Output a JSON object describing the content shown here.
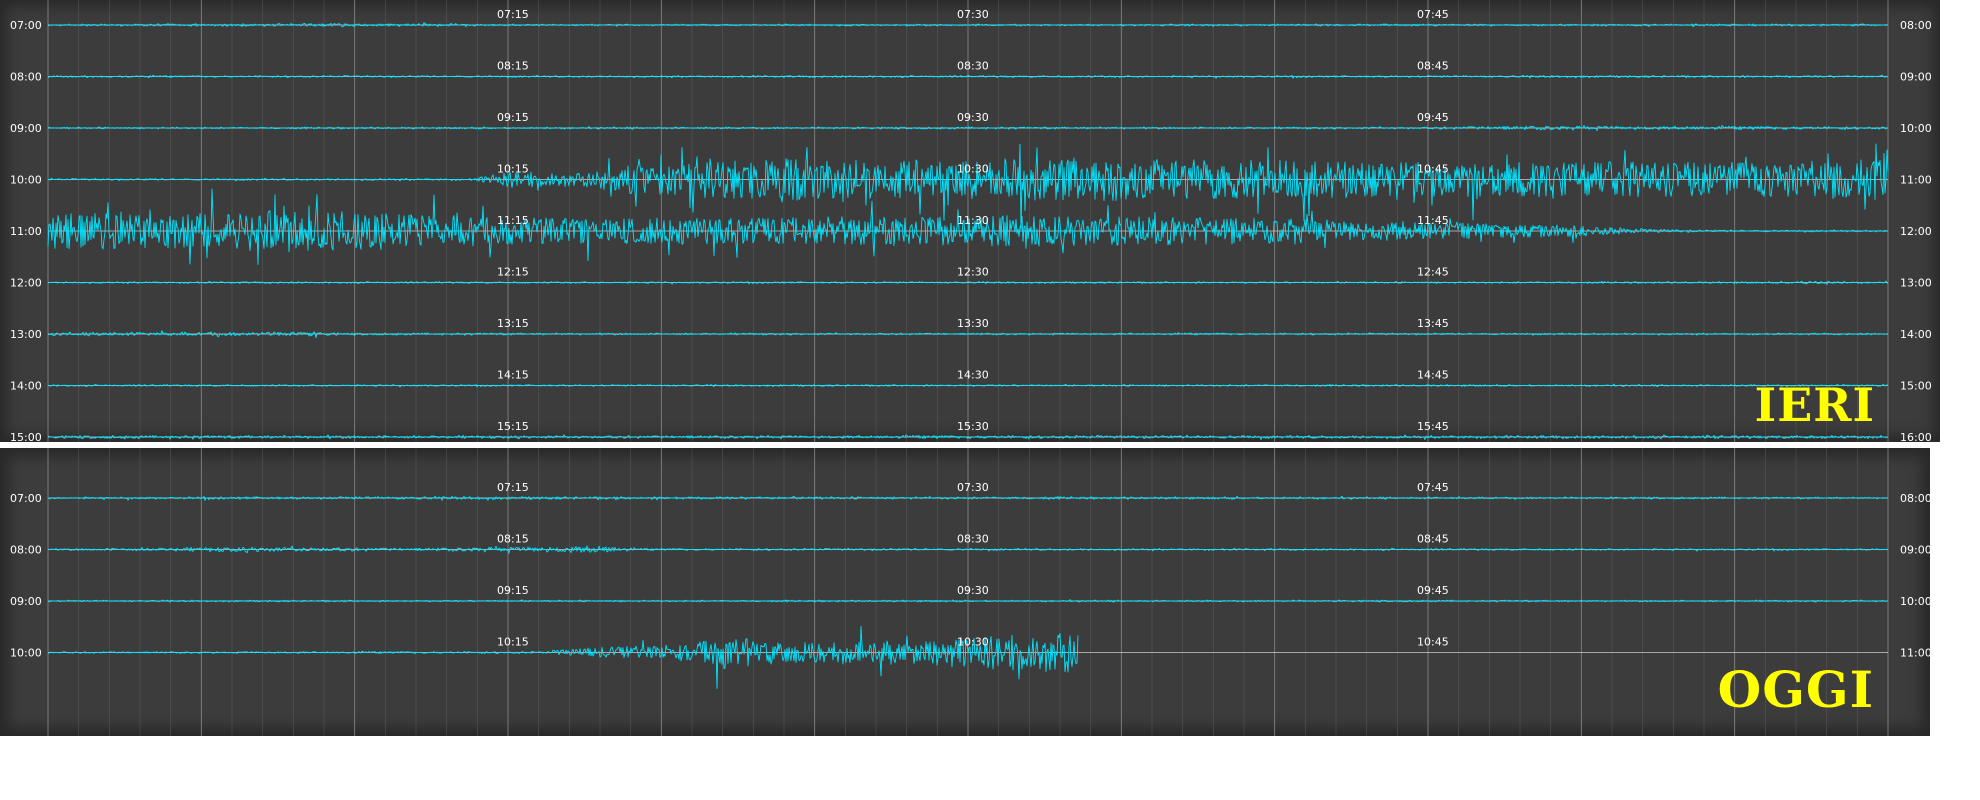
{
  "chart_data": [
    {
      "type": "line",
      "panel_label": "IERI",
      "colors": {
        "background": "#3c3c3c",
        "trace": "#00e5ff",
        "grid": "#7a7a7a",
        "tick_text": "#ffffff"
      },
      "rows": [
        {
          "left_label": "07:00",
          "right_label": "08:00",
          "mid_labels": [
            "07:15",
            "07:30",
            "07:45"
          ],
          "activity": [
            [
              0.0,
              0.03
            ],
            [
              0.17,
              0.06
            ],
            [
              0.25,
              0.02
            ],
            [
              1.0,
              0.03
            ]
          ]
        },
        {
          "left_label": "08:00",
          "right_label": "09:00",
          "mid_labels": [
            "08:15",
            "08:30",
            "08:45"
          ],
          "activity": [
            [
              0.0,
              0.02
            ],
            [
              1.0,
              0.03
            ]
          ]
        },
        {
          "left_label": "09:00",
          "right_label": "10:00",
          "mid_labels": [
            "09:15",
            "09:30",
            "09:45"
          ],
          "activity": [
            [
              0.0,
              0.02
            ],
            [
              0.74,
              0.03
            ],
            [
              0.8,
              0.08
            ],
            [
              1.0,
              0.04
            ]
          ]
        },
        {
          "left_label": "10:00",
          "right_label": "11:00",
          "mid_labels": [
            "10:15",
            "10:30",
            "10:45"
          ],
          "activity": [
            [
              0.0,
              0.02
            ],
            [
              0.23,
              0.03
            ],
            [
              0.25,
              0.35
            ],
            [
              0.29,
              0.3
            ],
            [
              0.31,
              0.6
            ],
            [
              0.4,
              0.95
            ],
            [
              0.48,
              0.85
            ],
            [
              0.56,
              1.0
            ],
            [
              0.65,
              0.85
            ],
            [
              0.78,
              0.8
            ],
            [
              0.9,
              0.8
            ],
            [
              1.0,
              0.9
            ]
          ]
        },
        {
          "left_label": "11:00",
          "right_label": "12:00",
          "mid_labels": [
            "11:15",
            "11:30",
            "11:45"
          ],
          "activity": [
            [
              0.0,
              0.8
            ],
            [
              0.1,
              0.8
            ],
            [
              0.11,
              1.0
            ],
            [
              0.2,
              0.75
            ],
            [
              0.3,
              0.55
            ],
            [
              0.45,
              0.65
            ],
            [
              0.55,
              0.7
            ],
            [
              0.68,
              0.55
            ],
            [
              0.76,
              0.35
            ],
            [
              0.83,
              0.25
            ],
            [
              0.86,
              0.1
            ],
            [
              0.9,
              0.03
            ],
            [
              1.0,
              0.02
            ]
          ]
        },
        {
          "left_label": "12:00",
          "right_label": "13:00",
          "mid_labels": [
            "12:15",
            "12:30",
            "12:45"
          ],
          "activity": [
            [
              0.0,
              0.02
            ],
            [
              0.94,
              0.02
            ],
            [
              0.96,
              0.08
            ],
            [
              0.98,
              0.02
            ],
            [
              1.0,
              0.02
            ]
          ]
        },
        {
          "left_label": "13:00",
          "right_label": "14:00",
          "mid_labels": [
            "13:15",
            "13:30",
            "13:45"
          ],
          "activity": [
            [
              0.0,
              0.06
            ],
            [
              0.15,
              0.08
            ],
            [
              0.16,
              0.03
            ],
            [
              1.0,
              0.02
            ]
          ]
        },
        {
          "left_label": "14:00",
          "right_label": "15:00",
          "mid_labels": [
            "14:15",
            "14:30",
            "14:45"
          ],
          "activity": [
            [
              0.0,
              0.02
            ],
            [
              1.0,
              0.02
            ]
          ]
        },
        {
          "left_label": "15:00",
          "right_label": "16:00",
          "mid_labels": [
            "15:15",
            "15:30",
            "15:45"
          ],
          "activity": [
            [
              0.0,
              0.05
            ],
            [
              1.0,
              0.05
            ]
          ]
        }
      ]
    },
    {
      "type": "line",
      "panel_label": "OGGI",
      "colors": {
        "background": "#3c3c3c",
        "trace": "#00e5ff",
        "grid": "#7a7a7a",
        "tick_text": "#ffffff"
      },
      "rows": [
        {
          "left_label": "07:00",
          "right_label": "08:00",
          "mid_labels": [
            "07:15",
            "07:30",
            "07:45"
          ],
          "activity": [
            [
              0.0,
              0.03
            ],
            [
              0.2,
              0.05
            ],
            [
              1.0,
              0.02
            ]
          ]
        },
        {
          "left_label": "08:00",
          "right_label": "09:00",
          "mid_labels": [
            "08:15",
            "08:30",
            "08:45"
          ],
          "activity": [
            [
              0.0,
              0.02
            ],
            [
              0.11,
              0.1
            ],
            [
              0.2,
              0.05
            ],
            [
              0.3,
              0.15
            ],
            [
              0.32,
              0.03
            ],
            [
              1.0,
              0.02
            ]
          ]
        },
        {
          "left_label": "09:00",
          "right_label": "10:00",
          "mid_labels": [
            "09:15",
            "09:30",
            "09:45"
          ],
          "activity": [
            [
              0.0,
              0.02
            ],
            [
              1.0,
              0.02
            ]
          ]
        },
        {
          "left_label": "10:00",
          "right_label": "11:00",
          "mid_labels": [
            "10:15",
            "10:30",
            "10:45"
          ],
          "activity": [
            [
              0.0,
              0.02
            ],
            [
              0.27,
              0.03
            ],
            [
              0.28,
              0.15
            ],
            [
              0.35,
              0.4
            ],
            [
              0.37,
              0.8
            ],
            [
              0.39,
              0.45
            ],
            [
              0.43,
              0.5
            ],
            [
              0.48,
              0.55
            ],
            [
              0.5,
              0.7
            ],
            [
              0.56,
              0.95
            ],
            [
              0.555,
              0.95
            ],
            [
              0.556,
              0.0
            ],
            [
              1.0,
              0.0
            ]
          ]
        }
      ]
    }
  ]
}
